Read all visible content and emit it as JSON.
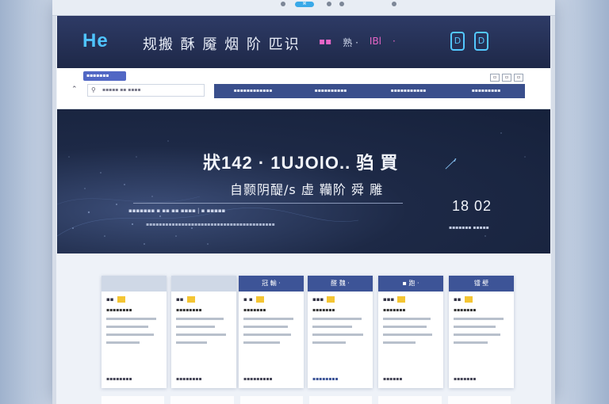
{
  "bezel": {
    "pill": "⌘"
  },
  "header": {
    "logo": "He",
    "title": "规搬 酥 魇 烟 阶 匹识",
    "nav": [
      "▪▪",
      "熟 ·",
      "IBl",
      "·"
    ],
    "icons": [
      "D",
      "D"
    ]
  },
  "toolbar": {
    "chip": "▪▪▪▪▪▪▪",
    "window_buttons": [
      "▫",
      "▫",
      "▫"
    ],
    "search_placeholder": "▪▪▪▪▪ ▪▪ ▪▪▪▪",
    "tabs": [
      "▪▪▪▪▪▪▪▪▪▪▪▪",
      "▪▪▪▪▪▪▪▪▪▪",
      "▪▪▪▪▪▪▪▪▪▪▪",
      "▪▪▪▪▪▪▪▪▪"
    ]
  },
  "hero": {
    "title": "狀142 · 1UJOlO..  驺 買",
    "subtitle": "自颢阴醍/s 虚 韊阶 舜 雕",
    "meta": "▪▪▪▪▪▪▪ ▪ ▪▪  ▪▪ ▪▪▪▪ | ▪ ▪▪▪▪▪",
    "desc": "▪▪▪▪▪▪▪▪▪▪▪▪▪▪▪▪▪▪▪▪▪▪▪▪▪▪▪▪▪▪▪▪▪▪▪▪▪▪▪▪",
    "mark": "ʹ̸",
    "number": "18 02",
    "number_label": "▪▪▪▪▪▪▪  ▪▪▪▪▪"
  },
  "cards": [
    {
      "head": "",
      "row1": "▪▪",
      "row2": "▪▪▪▪▪▪▪▪",
      "foot": "▪▪▪▪▪▪▪▪",
      "light": true
    },
    {
      "head": "",
      "row1": "▪▪",
      "row2": "▪▪▪▪▪▪▪▪",
      "foot": "▪▪▪▪▪▪▪▪",
      "light": true
    },
    {
      "head": "冠 輸 ·",
      "row1": "▪ ▪",
      "row2": "▪▪▪▪▪▪▪",
      "foot": "▪▪▪▪▪▪▪▪▪",
      "light": false
    },
    {
      "head": "醛 魏 ·",
      "row1": "▪▪▪",
      "row2": "▪▪▪▪▪▪▪",
      "foot": "▪▪▪▪▪▪▪▪",
      "light": false
    },
    {
      "head": "▪ 跑 ·",
      "row1": "▪▪▪",
      "row2": "▪▪▪▪▪▪▪",
      "foot": "▪▪▪▪▪▪",
      "light": false
    },
    {
      "head": "镭 壁",
      "row1": "▪▪",
      "row2": "▪▪▪▪▪▪▪",
      "foot": "▪▪▪▪▪▪▪",
      "light": false
    }
  ]
}
